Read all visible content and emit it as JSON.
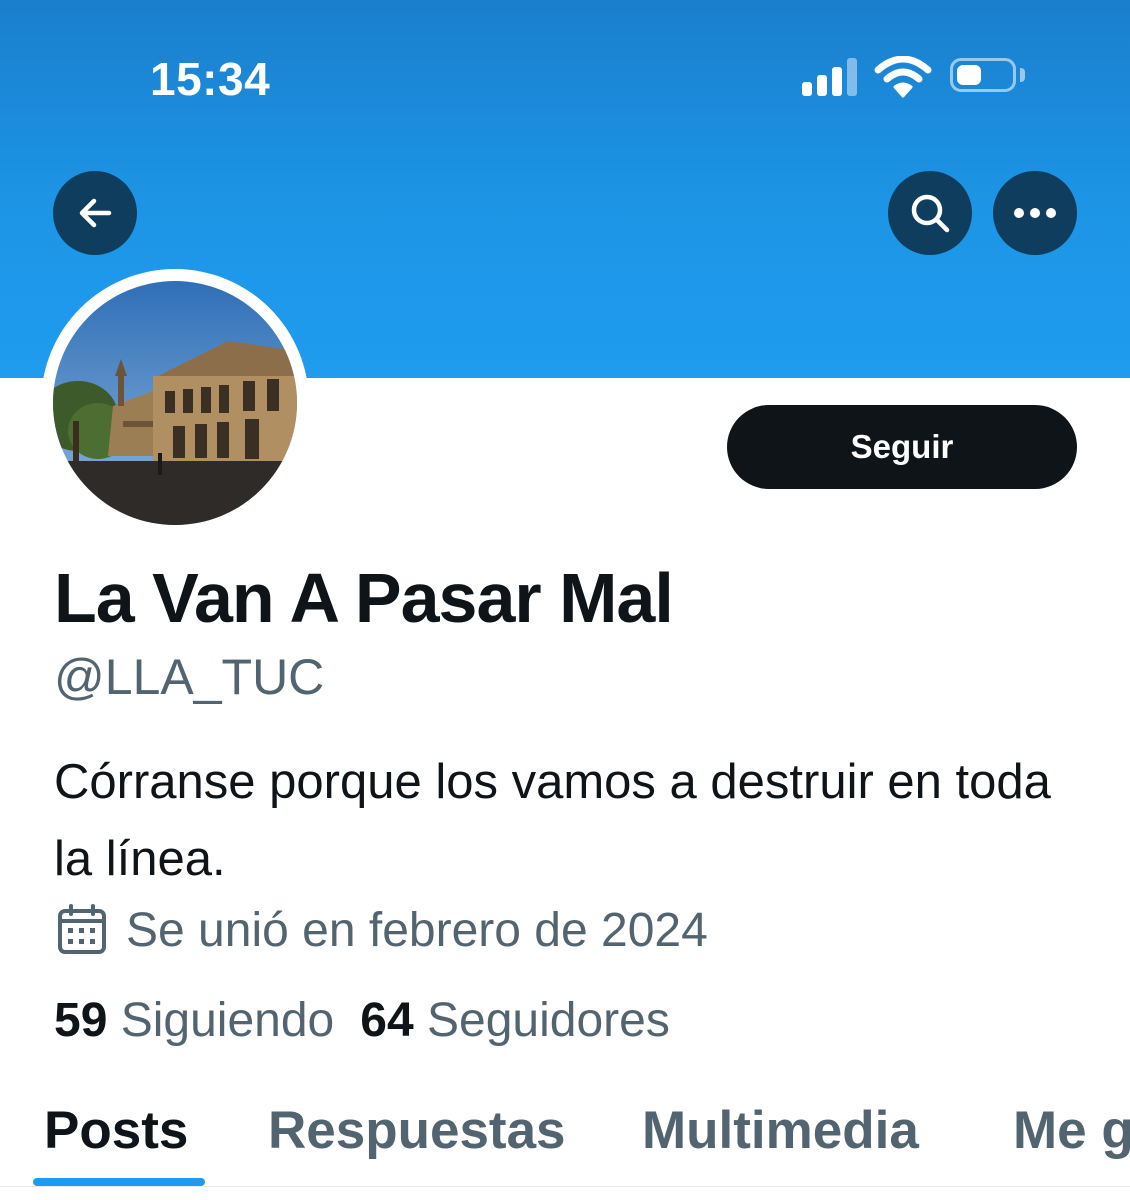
{
  "status_bar": {
    "time": "15:34",
    "icons": [
      "cellular-signal-icon",
      "wifi-icon",
      "battery-icon"
    ]
  },
  "colors": {
    "banner": "#1d95e6",
    "accent": "#1d9bf0",
    "follow_button": "#0f1419",
    "secondary_text": "#536471"
  },
  "header": {
    "back_icon": "arrow-left-icon",
    "search_icon": "search-icon",
    "more_icon": "more-horizontal-icon"
  },
  "profile": {
    "follow_label": "Seguir",
    "display_name": "La Van A Pasar Mal",
    "handle": "@LLA_TUC",
    "bio": "Córranse porque los vamos a destruir en toda la línea.",
    "joined_icon": "calendar-icon",
    "joined": "Se unió en febrero de 2024",
    "following_count": "59",
    "following_label": "Siguiendo",
    "followers_count": "64",
    "followers_label": "Seguidores"
  },
  "tabs": [
    {
      "label": "Posts",
      "active": true
    },
    {
      "label": "Respuestas",
      "active": false
    },
    {
      "label": "Multimedia",
      "active": false
    },
    {
      "label": "Me gusta",
      "active": false
    }
  ]
}
